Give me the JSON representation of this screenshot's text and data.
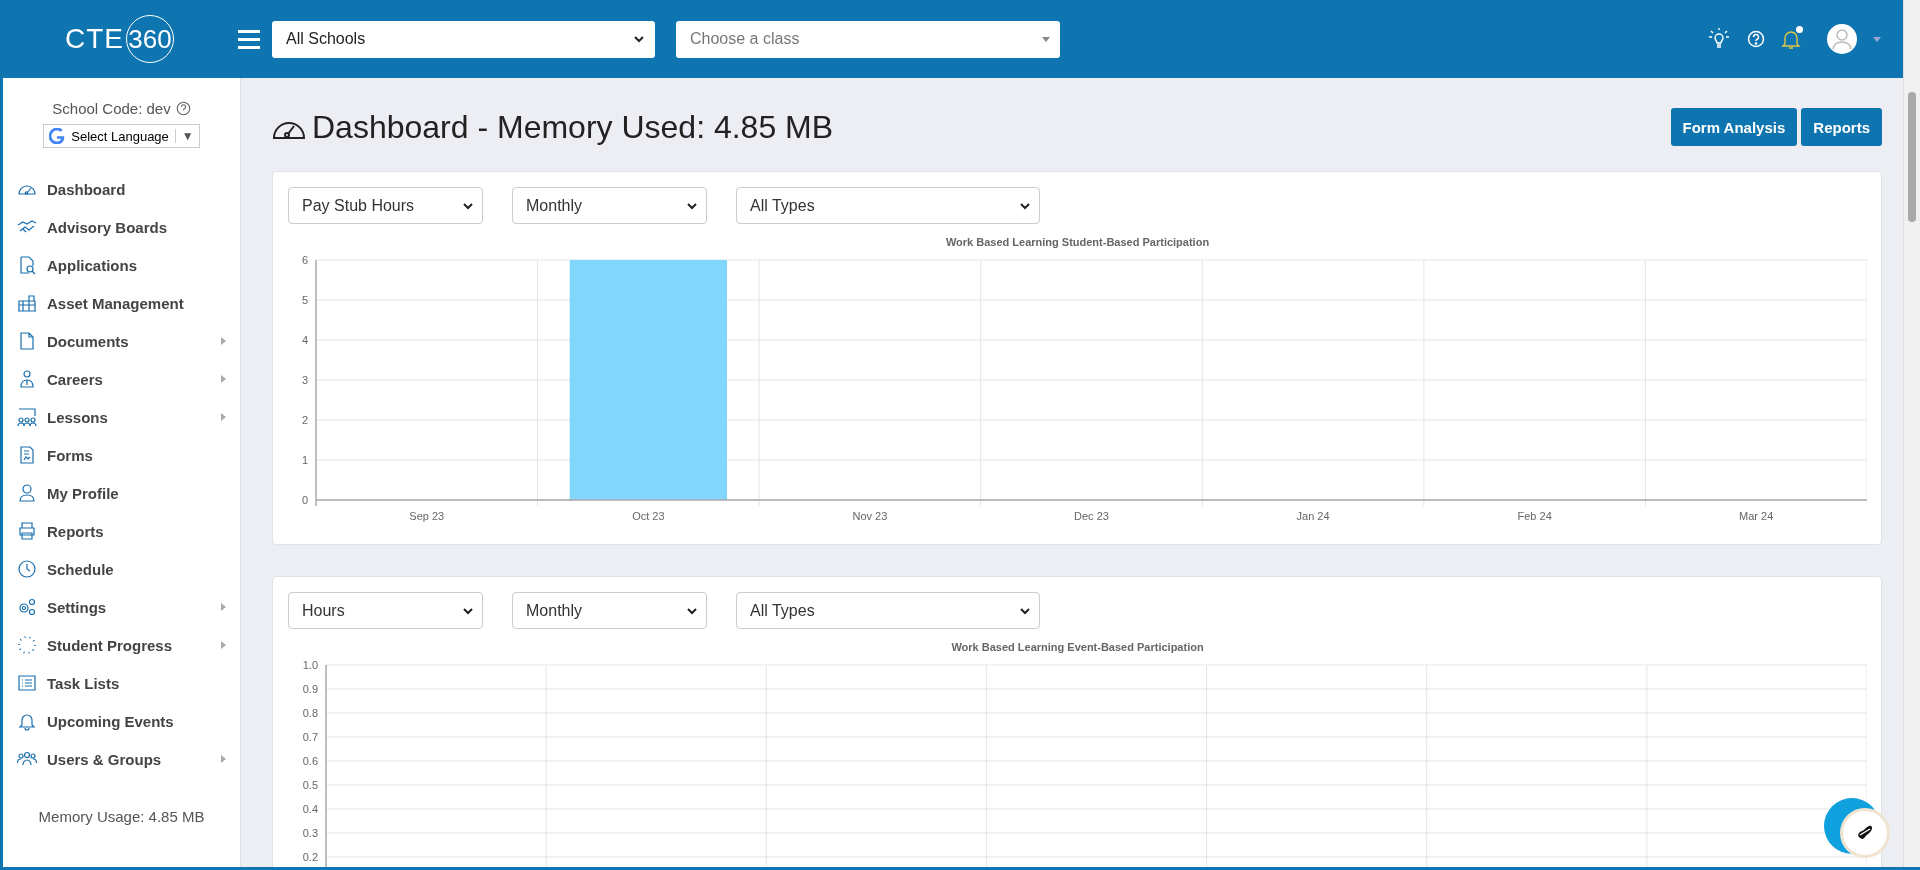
{
  "header": {
    "logo": {
      "text": "CTE",
      "number": "360"
    },
    "school_select": {
      "value": "All Schools"
    },
    "class_select": {
      "placeholder": "Choose a class"
    },
    "notifications": {
      "unread": true
    }
  },
  "sidebar": {
    "school_code": "School Code: dev",
    "language": {
      "label": "Select Language",
      "caret": "▼"
    },
    "items": [
      {
        "label": "Dashboard",
        "has_submenu": false
      },
      {
        "label": "Advisory Boards",
        "has_submenu": false
      },
      {
        "label": "Applications",
        "has_submenu": false
      },
      {
        "label": "Asset Management",
        "has_submenu": false
      },
      {
        "label": "Documents",
        "has_submenu": true
      },
      {
        "label": "Careers",
        "has_submenu": true
      },
      {
        "label": "Lessons",
        "has_submenu": true
      },
      {
        "label": "Forms",
        "has_submenu": false
      },
      {
        "label": "My Profile",
        "has_submenu": false
      },
      {
        "label": "Reports",
        "has_submenu": false
      },
      {
        "label": "Schedule",
        "has_submenu": false
      },
      {
        "label": "Settings",
        "has_submenu": true
      },
      {
        "label": "Student Progress",
        "has_submenu": true
      },
      {
        "label": "Task Lists",
        "has_submenu": false
      },
      {
        "label": "Upcoming Events",
        "has_submenu": false
      },
      {
        "label": "Users & Groups",
        "has_submenu": true
      }
    ],
    "memory_usage": "Memory Usage: 4.85 MB"
  },
  "page": {
    "title": "Dashboard - Memory Used: 4.85 MB",
    "buttons": [
      "Form Analysis",
      "Reports"
    ]
  },
  "cards": [
    {
      "filters": [
        "Pay Stub Hours",
        "Monthly",
        "All Types"
      ],
      "chart_data": {
        "type": "bar",
        "title": "Work Based Learning Student-Based Participation",
        "categories": [
          "Sep 23",
          "Oct 23",
          "Nov 23",
          "Dec 23",
          "Jan 24",
          "Feb 24",
          "Mar 24"
        ],
        "values": [
          0,
          6,
          0,
          0,
          0,
          0,
          0
        ],
        "grid": true,
        "ylim": [
          0,
          6
        ],
        "yticks": [
          0,
          1,
          2,
          3,
          4,
          5,
          6
        ]
      }
    },
    {
      "filters": [
        "Hours",
        "Monthly",
        "All Types"
      ],
      "chart_data": {
        "type": "bar",
        "title": "Work Based Learning Event-Based Participation",
        "categories": [
          null,
          null,
          null,
          null,
          null,
          null,
          null
        ],
        "values": [
          null,
          null,
          null,
          null,
          null,
          null,
          null
        ],
        "grid": true,
        "ylim": [
          0,
          1
        ],
        "yticks": [
          0.2,
          0.3,
          0.4,
          0.5,
          0.6,
          0.7,
          0.8,
          0.9,
          {
            "value": 1,
            "label": "1.0"
          }
        ]
      }
    }
  ]
}
